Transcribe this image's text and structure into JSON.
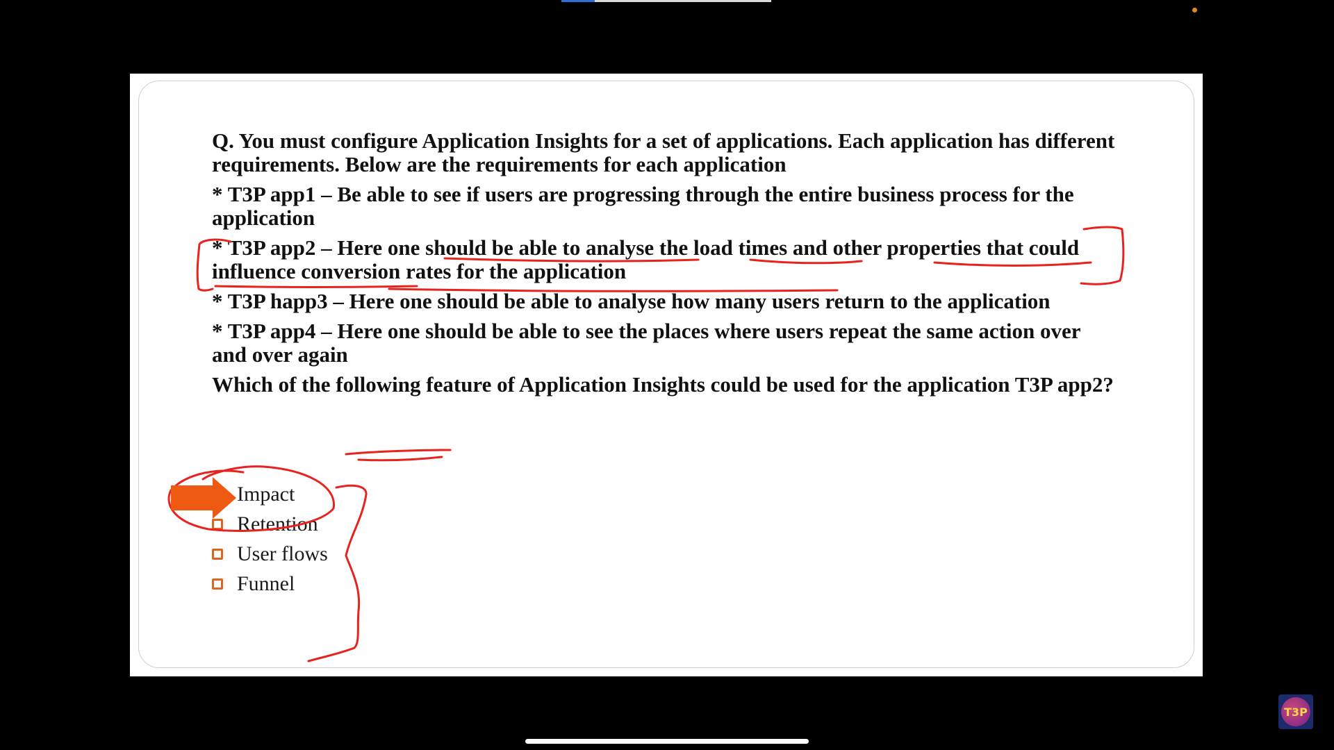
{
  "video": {
    "progress_fraction": 0.16
  },
  "slide": {
    "paragraphs": [
      "Q. You must configure Application Insights for a set of applications. Each application has different requirements. Below are the requirements for each application",
      "* T3P app1 – Be able to see if users are progressing through the entire business process for the application",
      "* T3P app2 – Here one should be able to analyse the load times and other properties that could influence conversion rates for the application",
      "* T3P happ3 – Here one should be able to analyse how many users return to the application",
      "* T3P app4 – Here one should be able to see the places where users repeat the same action over and over again",
      "Which of the following feature of Application Insights could be used for the application T3P app2?"
    ],
    "options": [
      "Impact",
      "Retention",
      "User flows",
      "Funnel"
    ]
  },
  "colors": {
    "annotation": "#e8231e",
    "arrow": "#ee5a12",
    "checkbox": "#e0641e"
  },
  "logo": {
    "text": "T3P"
  }
}
